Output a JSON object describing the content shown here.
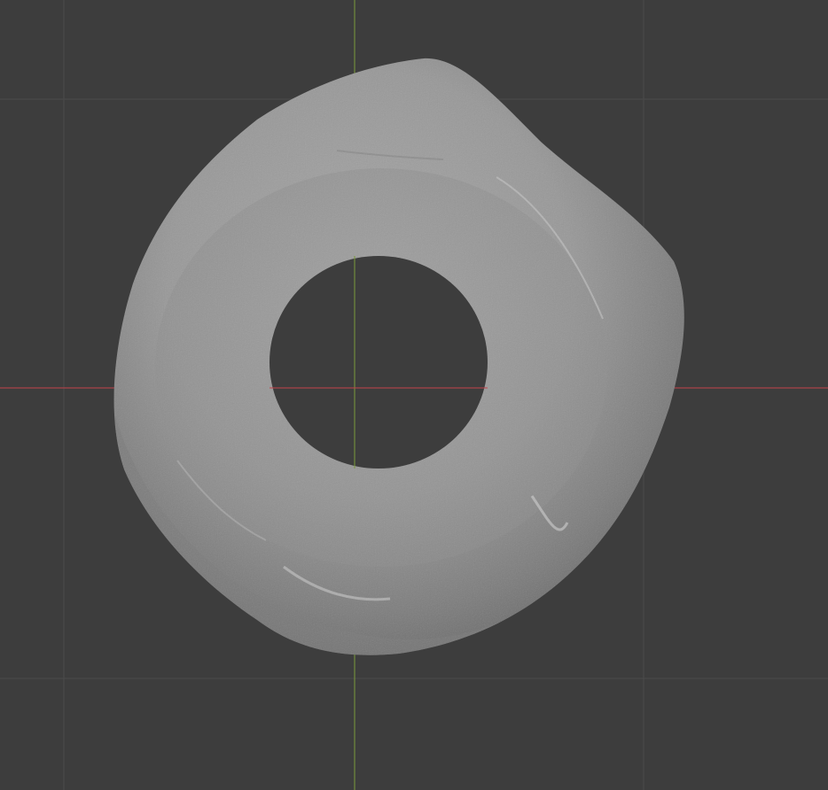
{
  "viewport": {
    "label": "",
    "background_color": "#3d3d3d",
    "grid_line_color": "#4a4a4a",
    "x_axis_color": "#c2424a",
    "y_axis_color": "#7a9a3a"
  },
  "object": {
    "name": "",
    "shape": "ring-like stone with central hole",
    "base_color": "#9a9a9a",
    "shadow_color": "#6e6e6e",
    "highlight_color": "#b5b5b5"
  }
}
